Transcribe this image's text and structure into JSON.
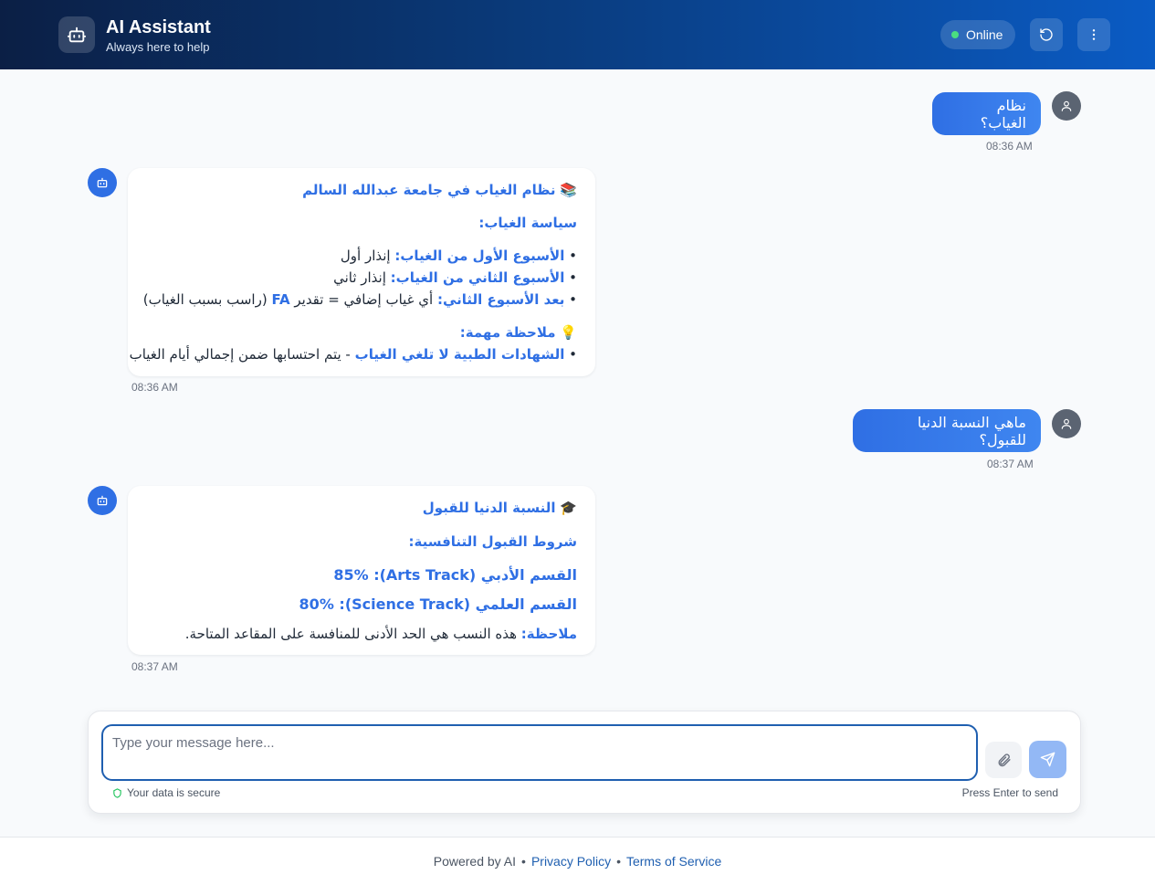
{
  "header": {
    "title": "AI Assistant",
    "subtitle": "Always here to help",
    "status": "Online",
    "bot_icon": "robot-icon",
    "refresh_icon": "refresh-icon",
    "menu_icon": "more-vertical-icon"
  },
  "messages": {
    "m1": {
      "text": "نظام الغياب؟",
      "time": "08:36 AM"
    },
    "m2": {
      "time": "08:36 AM",
      "emoji": "📚",
      "title": "نظام الغياب في جامعة عبدالله السالم",
      "policy_heading": "سياسة الغياب:",
      "b1_label": "الأسبوع الأول من الغياب:",
      "b1_text": " إنذار أول",
      "b2_label": "الأسبوع الثاني من الغياب:",
      "b2_text": " إنذار ثاني",
      "b3_label": "بعد الأسبوع الثاني:",
      "b3_text": " أي غياب إضافي = تقدير ",
      "b3_grade": "FA",
      "b3_tail": " (راسب بسبب الغياب)",
      "note_emoji": "💡",
      "note_heading": "ملاحظة مهمة:",
      "n1_label": "الشهادات الطبية لا تلغي الغياب",
      "n1_text": " - يتم احتسابها ضمن إجمالي أيام الغياب"
    },
    "m3": {
      "text": "ماهي النسبة الدنيا للقبول؟",
      "time": "08:37 AM"
    },
    "m4": {
      "time": "08:37 AM",
      "emoji": "🎓",
      "title": "النسبة الدنيا للقبول",
      "cond_heading": "شروط القبول التنافسية:",
      "arts": "القسم الأدبي (Arts Track): 85%",
      "science": "القسم العلمي (Science Track): 80%",
      "note_label": "ملاحظة:",
      "note_text": " هذه النسب هي الحد الأدنى للمنافسة على المقاعد المتاحة."
    }
  },
  "composer": {
    "placeholder": "Type your message here...",
    "secure_text": "Your data is secure",
    "hint": "Press Enter to send",
    "attach_icon": "paperclip-icon",
    "send_icon": "send-icon"
  },
  "footer": {
    "powered": "Powered by AI",
    "privacy": "Privacy Policy",
    "terms": "Terms of Service"
  },
  "colors": {
    "accent": "#2f6fe4",
    "header_start": "#0b1f45",
    "header_end": "#0a5bc4",
    "online": "#4ade80"
  }
}
